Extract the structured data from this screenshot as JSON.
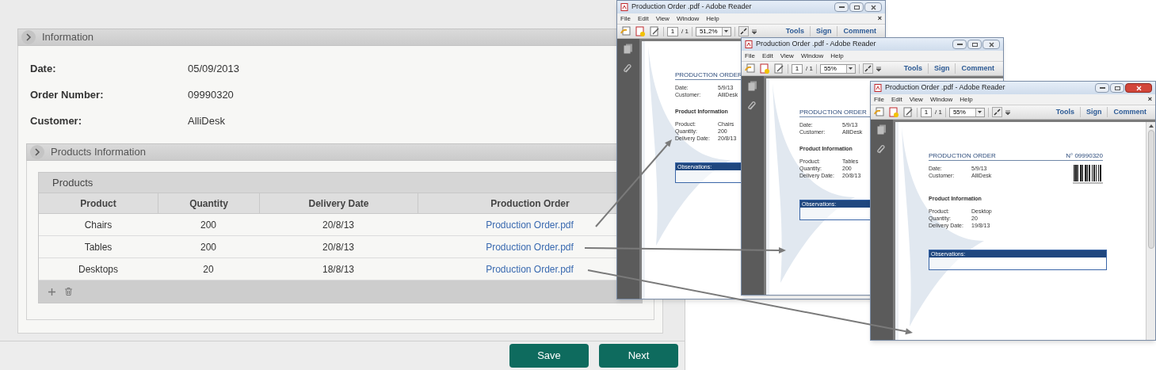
{
  "information": {
    "title": "Information",
    "fields": [
      {
        "label": "Date:",
        "value": "05/09/2013"
      },
      {
        "label": "Order Number:",
        "value": "09990320"
      },
      {
        "label": "Customer:",
        "value": "AlliDesk"
      }
    ]
  },
  "products_information": {
    "title": "Products Information",
    "grid": {
      "title": "Products",
      "columns": [
        "Product",
        "Quantity",
        "Delivery Date",
        "Production Order"
      ],
      "rows": [
        [
          "Chairs",
          "200",
          "20/8/13",
          "Production Order.pdf"
        ],
        [
          "Tables",
          "200",
          "20/8/13",
          "Production Order.pdf"
        ],
        [
          "Desktops",
          "20",
          "18/8/13",
          "Production Order.pdf"
        ]
      ]
    }
  },
  "buttons": [
    "Save",
    "Next"
  ],
  "pdf_windows": [
    {
      "title": "Production Order .pdf - Adobe Reader",
      "active": false,
      "menu": [
        "File",
        "Edit",
        "View",
        "Window",
        "Help"
      ],
      "menu_close": "×",
      "page": "1",
      "page_count": "/ 1",
      "zoom": "51,2%",
      "tool_buttons": [
        "Tools",
        "Sign",
        "Comment"
      ],
      "document": {
        "heading": "PRODUCTION ORDER",
        "fields": [
          {
            "label": "Date:",
            "value": "5/9/13"
          },
          {
            "label": "Customer:",
            "value": "AlliDesk"
          }
        ],
        "section": "Product Information",
        "product_fields": [
          {
            "label": "Product:",
            "value": "Chairs"
          },
          {
            "label": "Quantity:",
            "value": "200"
          },
          {
            "label": "Delivery Date:",
            "value": "20/8/13"
          }
        ],
        "observations": "Observations:"
      }
    },
    {
      "title": "Production Order .pdf - Adobe Reader",
      "active": false,
      "menu": [
        "File",
        "Edit",
        "View",
        "Window",
        "Help"
      ],
      "page": "1",
      "page_count": "/ 1",
      "zoom": "55%",
      "tool_buttons": [
        "Tools",
        "Sign",
        "Comment"
      ],
      "document": {
        "heading": "PRODUCTION ORDER",
        "fields": [
          {
            "label": "Date:",
            "value": "5/9/13"
          },
          {
            "label": "Customer:",
            "value": "AlliDesk"
          }
        ],
        "section": "Product Information",
        "product_fields": [
          {
            "label": "Product:",
            "value": "Tables"
          },
          {
            "label": "Quantity:",
            "value": "200"
          },
          {
            "label": "Delivery Date:",
            "value": "20/8/13"
          }
        ],
        "observations": "Observations:"
      }
    },
    {
      "title": "Production Order .pdf - Adobe Reader",
      "active": true,
      "menu": [
        "File",
        "Edit",
        "View",
        "Window",
        "Help"
      ],
      "menu_close": "×",
      "page": "1",
      "page_count": "/ 1",
      "zoom": "55%",
      "tool_buttons": [
        "Tools",
        "Sign",
        "Comment"
      ],
      "document": {
        "heading": "PRODUCTION ORDER",
        "order_number": "N° 09990320",
        "fields": [
          {
            "label": "Date:",
            "value": "5/9/13"
          },
          {
            "label": "Customer:",
            "value": "AlliDesk"
          }
        ],
        "section": "Product Information",
        "product_fields": [
          {
            "label": "Product:",
            "value": "Desktop"
          },
          {
            "label": "Quantity:",
            "value": "20"
          },
          {
            "label": "Delivery Date:",
            "value": "19/8/13"
          }
        ],
        "observations": "Observations:"
      }
    }
  ]
}
